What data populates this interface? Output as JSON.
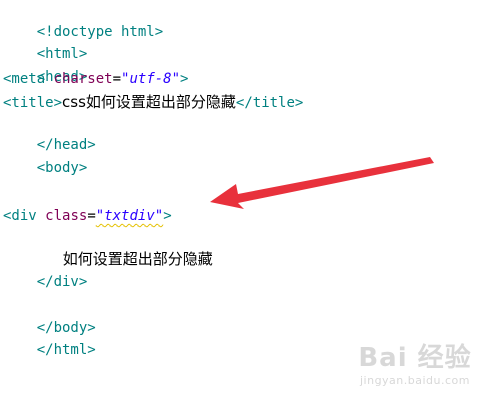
{
  "editor": {
    "lines": {
      "doctype": "<!doctype html>",
      "html_open": "<html>",
      "head_open": "<head>",
      "meta": {
        "open": "<meta ",
        "attr": "charset",
        "eq": "=",
        "value": "\"utf-8\"",
        "close": ">"
      },
      "title": {
        "open": "<title>",
        "text": "css如何设置超出部分隐藏",
        "close": "</title>"
      },
      "head_close": "</head>",
      "body_open": "<body>",
      "div": {
        "open": "<div ",
        "attr": "class",
        "eq": "=",
        "value": "\"txtdiv\"",
        "close": ">"
      },
      "div_text": "如何设置超出部分隐藏",
      "div_close": "</div>",
      "body_close": "</body>",
      "html_close": "</html>"
    }
  },
  "colors": {
    "tag": "#008080",
    "attribute": "#7f0055",
    "string": "#2a00ff",
    "arrow": "#e8313c"
  },
  "watermark": {
    "logo": "Bai 经验",
    "url": "jingyan.baidu.com"
  }
}
